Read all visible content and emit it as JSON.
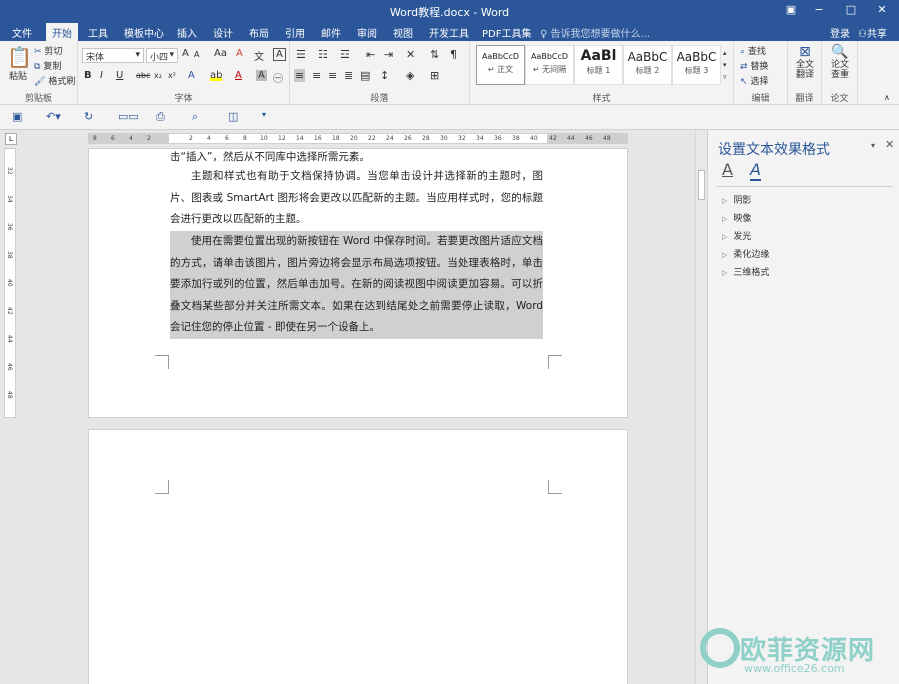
{
  "titlebar": {
    "title": "Word教程.docx - Word",
    "ribbon_display": "▣",
    "minimize": "−",
    "restore": "□",
    "close": "✕"
  },
  "tabs": [
    "文件",
    "开始",
    "工具",
    "模板中心",
    "插入",
    "设计",
    "布局",
    "引用",
    "邮件",
    "审阅",
    "视图",
    "开发工具",
    "PDF工具集"
  ],
  "active_tab": "开始",
  "tell_me": "告诉我您想要做什么...",
  "login": "登录",
  "share": "共享",
  "clipboard": {
    "paste": "粘贴",
    "cut": "剪切",
    "copy": "复制",
    "format_painter": "格式刷",
    "label": "剪贴板"
  },
  "font": {
    "name": "宋体",
    "size": "小四",
    "grow": "A",
    "shrink": "A",
    "case": "Aa",
    "clear": "A",
    "wen": "文",
    "bold": "B",
    "italic": "I",
    "underline": "U",
    "strike": "abc",
    "sub": "x₂",
    "sup": "x²",
    "label": "字体"
  },
  "paragraph": {
    "label": "段落"
  },
  "styles": {
    "items": [
      {
        "sample": "AaBbCcD",
        "name": "↵ 正文"
      },
      {
        "sample": "AaBbCcD",
        "name": "↵ 无间隔"
      },
      {
        "sample": "AaBl",
        "name": "标题 1"
      },
      {
        "sample": "AaBbC",
        "name": "标题 2"
      },
      {
        "sample": "AaBbC",
        "name": "标题 3"
      }
    ],
    "label": "样式"
  },
  "editing": {
    "find": "查找",
    "replace": "替换",
    "select": "选择",
    "label": "编辑"
  },
  "translate": {
    "button": "全文翻译",
    "label": "翻译"
  },
  "paper": {
    "button": "论文查重",
    "label": "论文"
  },
  "ruler_h_ticks": [
    "8",
    "6",
    "4",
    "2",
    "",
    "2",
    "4",
    "6",
    "8",
    "10",
    "12",
    "14",
    "16",
    "18",
    "20",
    "22",
    "24",
    "26",
    "28",
    "30",
    "32",
    "34",
    "36",
    "38",
    "40",
    "42",
    "44",
    "46",
    "48"
  ],
  "ruler_v_ticks": [
    "32",
    "34",
    "36",
    "38",
    "40",
    "42",
    "44",
    "46",
    "48"
  ],
  "document": {
    "p1": "击“插入”，然后从不同库中选择所需元素。",
    "p2": "主题和样式也有助于文档保持协调。当您单击设计并选择新的主题时，图片、图表或 SmartArt 图形将会更改以匹配新的主题。当应用样式时，您的标题会进行更改以匹配新的主题。",
    "p3": "使用在需要位置出现的新按钮在 Word 中保存时间。若要更改图片适应文档的方式，请单击该图片，图片旁边将会显示布局选项按钮。当处理表格时，单击要添加行或列的位置，然后单击加号。在新的阅读视图中阅读更加容易。可以折叠文档某些部分并关注所需文本。如果在达到结尾处之前需要停止读取，Word 会记住您的停止位置 - 即使在另一个设备上。"
  },
  "pane": {
    "title": "设置文本效果格式",
    "tab_fill": "A",
    "tab_effects": "A",
    "items": [
      "阴影",
      "映像",
      "发光",
      "柔化边缘",
      "三维格式"
    ]
  },
  "watermark": {
    "brand": "欧菲资源网",
    "url": "www.office26.com"
  },
  "colors": {
    "accent": "#2b579a",
    "selection": "#d0d0d0"
  }
}
